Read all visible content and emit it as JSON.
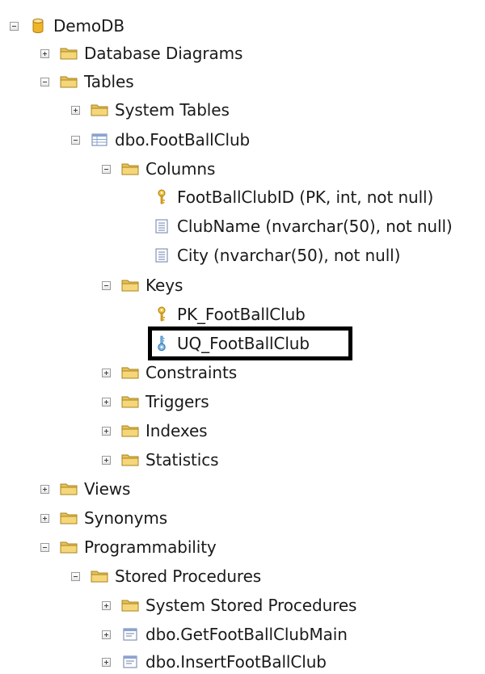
{
  "tree": {
    "db": "DemoDB",
    "database_diagrams": "Database Diagrams",
    "tables": "Tables",
    "system_tables": "System Tables",
    "table": "dbo.FootBallClub",
    "columns": "Columns",
    "col_id": "FootBallClubID (PK, int, not null)",
    "col_name": "ClubName (nvarchar(50), not null)",
    "col_city": "City (nvarchar(50), not null)",
    "keys": "Keys",
    "pk": "PK_FootBallClub",
    "uq": "UQ_FootBallClub",
    "constraints": "Constraints",
    "triggers": "Triggers",
    "indexes": "Indexes",
    "statistics": "Statistics",
    "views": "Views",
    "synonyms": "Synonyms",
    "programmability": "Programmability",
    "stored_procedures": "Stored Procedures",
    "system_stored_procedures": "System Stored Procedures",
    "sp_get": "dbo.GetFootBallClubMain",
    "sp_insert": "dbo.InsertFootBallClub"
  },
  "colors": {
    "folder": "#e8c15a",
    "database": "#f0b429",
    "key_gold": "#e0a21c",
    "key_blue": "#5aa0d8",
    "highlight": "#000000"
  }
}
